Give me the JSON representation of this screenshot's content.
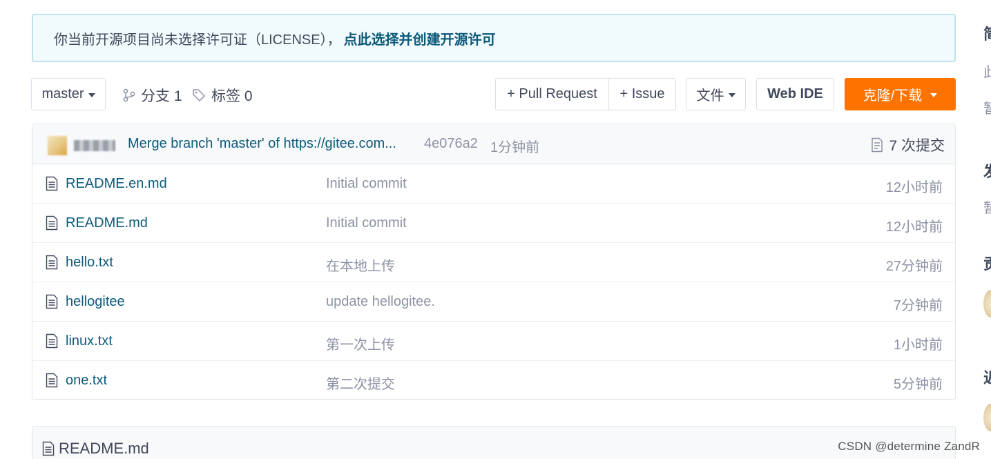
{
  "notice": {
    "text": "你当前开源项目尚未选择许可证（LICENSE），",
    "link": "点此选择并创建开源许可"
  },
  "toolbar": {
    "branch_select": "master",
    "branches_label": "分支 1",
    "tags_label": "标签 0",
    "pull_request": "+ Pull Request",
    "issue": "+ Issue",
    "file_menu": "文件",
    "web_ide": "Web IDE",
    "clone": "克隆/下载"
  },
  "commit": {
    "message": "Merge branch 'master' of https://gitee.com...",
    "hash": "4e076a2",
    "time": "1分钟前",
    "count": "7 次提交"
  },
  "files": [
    {
      "name": "README.en.md",
      "message": "Initial commit",
      "time": "12小时前"
    },
    {
      "name": "README.md",
      "message": "Initial commit",
      "time": "12小时前"
    },
    {
      "name": "hello.txt",
      "message": "在本地上传",
      "time": "27分钟前"
    },
    {
      "name": "hellogitee",
      "message": "update hellogitee.",
      "time": "7分钟前"
    },
    {
      "name": "linux.txt",
      "message": "第一次上传",
      "time": "1小时前"
    },
    {
      "name": "one.txt",
      "message": "第二次提交",
      "time": "5分钟前"
    }
  ],
  "readme": {
    "title": "README.md"
  },
  "sidebar_fragments": [
    "简",
    "此",
    "暂",
    "发",
    "暂",
    "贡",
    "近"
  ],
  "watermark": "CSDN @determine ZandR",
  "colors": {
    "accent": "#fe7300",
    "link": "#0c5a7a",
    "muted": "#8c92a4",
    "notice_bg": "#f1fafd"
  },
  "icons": {
    "branch": "branch-icon",
    "tag": "tag-icon",
    "file": "file-icon",
    "commits": "commits-icon"
  }
}
